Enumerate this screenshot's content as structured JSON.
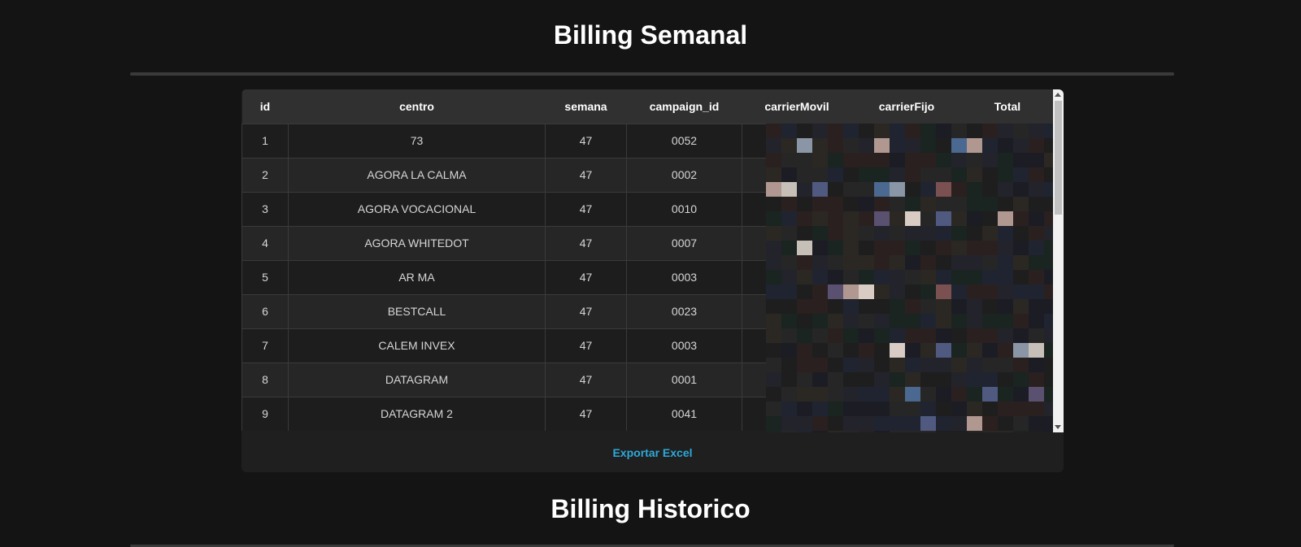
{
  "header": {
    "title": "Billing Semanal"
  },
  "table": {
    "columns": [
      "id",
      "centro",
      "semana",
      "campaign_id",
      "carrierMovil",
      "carrierFijo",
      "Total"
    ],
    "rows": [
      [
        "1",
        "73",
        "47",
        "0052",
        "",
        "",
        ""
      ],
      [
        "2",
        "AGORA LA CALMA",
        "47",
        "0002",
        "",
        "",
        ""
      ],
      [
        "3",
        "AGORA VOCACIONAL",
        "47",
        "0010",
        "",
        "",
        ""
      ],
      [
        "4",
        "AGORA WHITEDOT",
        "47",
        "0007",
        "",
        "",
        ""
      ],
      [
        "5",
        "AR MA",
        "47",
        "0003",
        "",
        "",
        ""
      ],
      [
        "6",
        "BESTCALL",
        "47",
        "0023",
        "",
        "",
        ""
      ],
      [
        "7",
        "CALEM INVEX",
        "47",
        "0003",
        "",
        "",
        ""
      ],
      [
        "8",
        "DATAGRAM",
        "47",
        "0001",
        "",
        "",
        ""
      ],
      [
        "9",
        "DATAGRAM 2",
        "47",
        "0041",
        "",
        "",
        ""
      ]
    ]
  },
  "footer": {
    "export_label": "Exportar Excel"
  },
  "section2": {
    "title": "Billing Historico"
  },
  "colors": {
    "accent": "#2ea8d8",
    "background": "#141414"
  }
}
